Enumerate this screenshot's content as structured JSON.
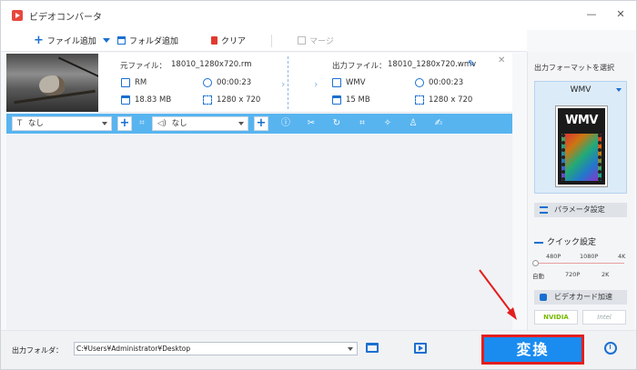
{
  "window": {
    "title": "ビデオコンバータ",
    "minimize": "—",
    "close": "✕"
  },
  "toolbar": {
    "add_file": "ファイル追加",
    "add_folder": "フォルダ追加",
    "clear": "クリア",
    "merge": "マージ"
  },
  "file": {
    "source_label": "元ファイル：",
    "source_name": "18010_1280x720.rm",
    "source_format": "RM",
    "source_duration": "00:00:23",
    "source_size": "18.83 MB",
    "source_resolution": "1280 x 720",
    "output_label": "出力ファイル：",
    "output_name": "18010_1280x720.wmv",
    "output_format": "WMV",
    "output_duration": "00:00:23",
    "output_size": "15 MB",
    "output_resolution": "1280 x 720"
  },
  "editbar": {
    "subtitle_value": "なし",
    "audio_value": "なし"
  },
  "format_panel": {
    "title": "出力フォーマットを選択",
    "selected_format": "WMV",
    "icon_text": "WMV",
    "param_button": "パラメータ設定",
    "quick_title": "クイック設定",
    "quality_top": [
      "480P",
      "1080P",
      "4K"
    ],
    "quality_bottom": [
      "自動",
      "720P",
      "2K"
    ],
    "quality_level": "自動",
    "gpu_button": "ビデオカード加速",
    "gpu_nvidia": "NVIDIA",
    "gpu_intel": "Intel"
  },
  "bottom": {
    "output_folder_label": "出力フォルダ：",
    "output_path": "C:¥Users¥Administrator¥Desktop",
    "convert_button": "変換"
  },
  "colors": {
    "accent": "#1a8cf0",
    "editbar": "#58b4ef",
    "highlight": "#e31e1e"
  }
}
